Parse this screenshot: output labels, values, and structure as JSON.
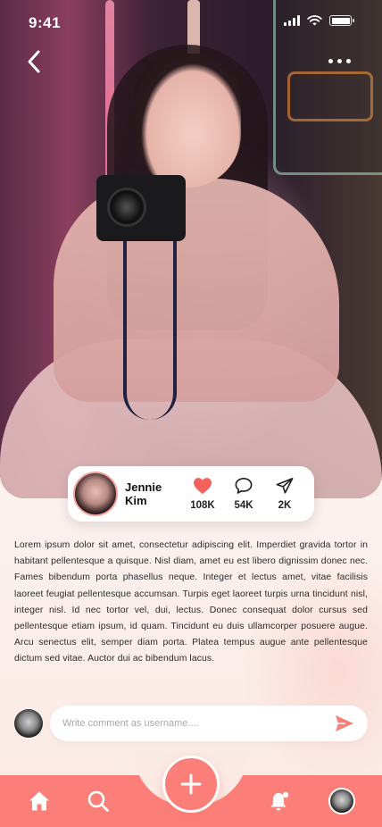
{
  "status_bar": {
    "time": "9:41"
  },
  "post": {
    "author_name": "Jennie Kim",
    "likes": "108K",
    "comments": "54K",
    "shares": "2K",
    "body": "Lorem ipsum dolor sit amet, consectetur adipiscing elit. Imperdiet gravida tortor in habitant pellentesque a quisque. Nisl diam, amet eu est libero dignissim donec nec. Fames bibendum porta phasellus neque. Integer et lectus amet, vitae facilisis laoreet feugiat pellentesque accumsan. Turpis eget laoreet turpis urna tincidunt nisl, integer nisl. Id nec tortor vel, dui, lectus. Donec consequat dolor cursus sed pellentesque etiam ipsum, id quam. Tincidunt eu duis ullamcorper posuere augue. Arcu senectus elit, semper diam porta. Platea tempus augue ante pellentesque dictum sed vitae. Auctor dui ac bibendum lacus."
  },
  "comment": {
    "placeholder": "Write comment as username...."
  },
  "colors": {
    "accent": "#fb7e78",
    "like": "#f2615b",
    "text": "#2b2b2b"
  },
  "icons": {
    "back": "chevron-left-icon",
    "more": "more-dots-icon",
    "like": "heart-icon",
    "comment": "chat-bubble-icon",
    "share": "paper-plane-icon",
    "send": "send-icon",
    "home": "home-icon",
    "search": "search-icon",
    "add": "plus-icon",
    "notifications": "bell-icon"
  }
}
